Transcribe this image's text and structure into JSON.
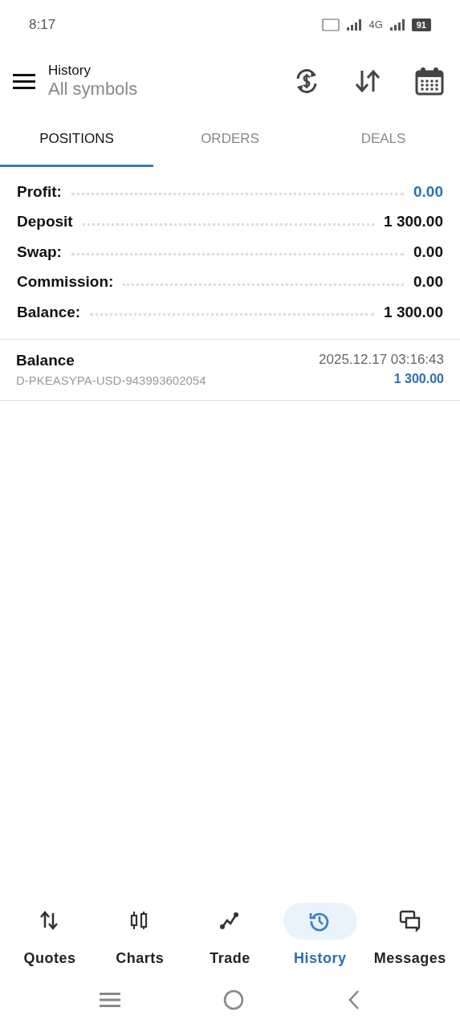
{
  "status_bar": {
    "time": "8:17",
    "network": "4G",
    "battery": "91"
  },
  "header": {
    "title": "History",
    "subtitle": "All symbols"
  },
  "tabs": [
    {
      "label": "POSITIONS",
      "selected": true
    },
    {
      "label": "ORDERS",
      "selected": false
    },
    {
      "label": "DEALS",
      "selected": false
    }
  ],
  "summary": [
    {
      "label": "Profit:",
      "value": "0.00",
      "highlighted": true
    },
    {
      "label": "Deposit",
      "value": "1 300.00",
      "highlighted": false
    },
    {
      "label": "Swap:",
      "value": "0.00",
      "highlighted": false
    },
    {
      "label": "Commission:",
      "value": "0.00",
      "highlighted": false
    },
    {
      "label": "Balance:",
      "value": "1 300.00",
      "highlighted": false
    }
  ],
  "deals": [
    {
      "type": "Balance",
      "comment": "D-PKEASYPA-USD-943993602054",
      "time": "2025.12.17 03:16:43",
      "amount": "1 300.00"
    }
  ],
  "bottom_nav": [
    {
      "label": "Quotes",
      "selected": false
    },
    {
      "label": "Charts",
      "selected": false
    },
    {
      "label": "Trade",
      "selected": false
    },
    {
      "label": "History",
      "selected": true
    },
    {
      "label": "Messages",
      "selected": false
    }
  ]
}
